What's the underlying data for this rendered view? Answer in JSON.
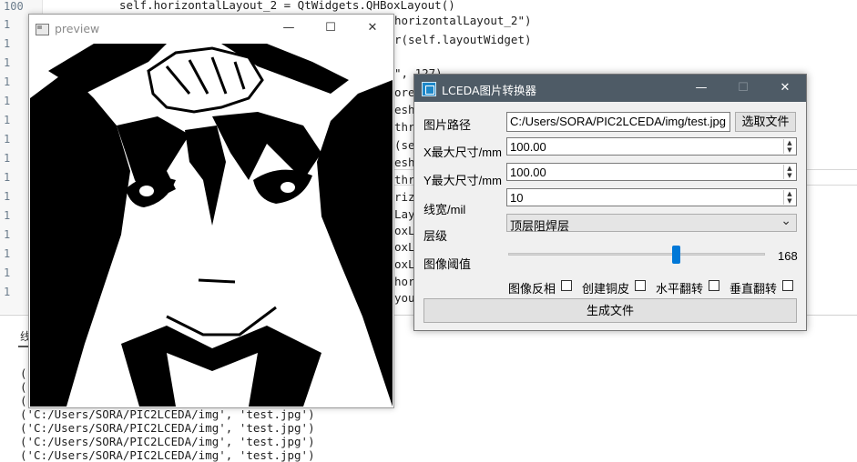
{
  "editor": {
    "gutter_top": "100",
    "gutter_rest": [
      "1",
      "1",
      "1",
      "1",
      "1",
      "1",
      "1",
      "1",
      "1",
      "1",
      "1",
      "1",
      "1",
      "1",
      "1"
    ],
    "line1": "self.horizontalLayout_2 = QtWidgets.QHBoxLayout()",
    "frags": [
      "horizontalLayout_2\")",
      "r(self.layoutWidget)",
      "\", 127)",
      "ore",
      "esh",
      "thr",
      "(se",
      "esh",
      "thr",
      "riz",
      "Lay",
      "oxL",
      "oxL",
      "oxL",
      "hor",
      "you"
    ]
  },
  "console": {
    "tab_label": "线",
    "lines": [
      "(",
      "(",
      "(",
      "('C:/Users/SORA/PIC2LCEDA/img', 'test.jpg')",
      "('C:/Users/SORA/PIC2LCEDA/img', 'test.jpg')",
      "('C:/Users/SORA/PIC2LCEDA/img', 'test.jpg')",
      "('C:/Users/SORA/PIC2LCEDA/img', 'test.jpg')"
    ]
  },
  "preview": {
    "title": "preview",
    "minimize": "—",
    "maximize": "☐",
    "close": "✕"
  },
  "converter": {
    "title": "LCEDA图片转换器",
    "minimize": "—",
    "maximize": "☐",
    "close": "✕",
    "path_label": "图片路径",
    "path_value": "C:/Users/SORA/PIC2LCEDA/img/test.jpg",
    "choose_button": "选取文件",
    "x_label": "X最大尺寸/mm",
    "x_value": "100.00",
    "y_label": "Y最大尺寸/mm",
    "y_value": "100.00",
    "width_label": "线宽/mil",
    "width_value": "10",
    "layer_label": "层级",
    "layer_value": "顶层阻焊层",
    "threshold_label": "图像阈值",
    "threshold_value": "168",
    "threshold_fraction": 0.659,
    "invert_label": "图像反相",
    "copper_label": "创建铜皮",
    "hflip_label": "水平翻转",
    "vflip_label": "垂直翻转",
    "generate_button": "生成文件",
    "spin_up": "▲",
    "spin_down": "▼",
    "dropdown_arrow": "⌄",
    "accent": "#0078d7",
    "titlebar_color": "#4e5b66"
  }
}
